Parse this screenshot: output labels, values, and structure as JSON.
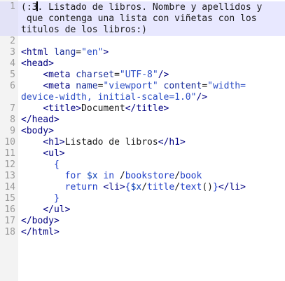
{
  "editor": {
    "lines": [
      {
        "n": "1",
        "parts": [
          [
            "plain",
            "(:3"
          ],
          [
            "cursor",
            ""
          ],
          [
            "plain",
            ". Listado de libros. Nombre y apellidos y"
          ]
        ]
      },
      {
        "n": "",
        "parts": [
          [
            "plain",
            " que contenga una lista con viñetas con los"
          ]
        ]
      },
      {
        "n": "",
        "parts": [
          [
            "plain",
            "titulos de los libros:)"
          ]
        ]
      },
      {
        "n": "2",
        "parts": []
      },
      {
        "n": "3",
        "parts": [
          [
            "tag",
            "<html "
          ],
          [
            "attr",
            "lang"
          ],
          [
            "plain",
            "="
          ],
          [
            "val",
            "\"en\""
          ],
          [
            "tag",
            ">"
          ]
        ]
      },
      {
        "n": "4",
        "parts": [
          [
            "tag",
            "<head>"
          ]
        ]
      },
      {
        "n": "5",
        "parts": [
          [
            "plain",
            "    "
          ],
          [
            "tag",
            "<meta "
          ],
          [
            "attr",
            "charset"
          ],
          [
            "plain",
            "="
          ],
          [
            "val",
            "\"UTF-8\""
          ],
          [
            "tag",
            "/>"
          ]
        ]
      },
      {
        "n": "6",
        "parts": [
          [
            "plain",
            "    "
          ],
          [
            "tag",
            "<meta "
          ],
          [
            "attr",
            "name"
          ],
          [
            "plain",
            "="
          ],
          [
            "val",
            "\"viewport\""
          ],
          [
            "plain",
            " "
          ],
          [
            "attr",
            "content"
          ],
          [
            "plain",
            "="
          ],
          [
            "val",
            "\"width="
          ]
        ]
      },
      {
        "n": "",
        "parts": [
          [
            "val",
            "device-width, initial-scale=1.0\""
          ],
          [
            "tag",
            "/>"
          ]
        ]
      },
      {
        "n": "7",
        "parts": [
          [
            "plain",
            "    "
          ],
          [
            "tag",
            "<title>"
          ],
          [
            "plain",
            "Document"
          ],
          [
            "tag",
            "</title>"
          ]
        ]
      },
      {
        "n": "8",
        "parts": [
          [
            "tag",
            "</head>"
          ]
        ]
      },
      {
        "n": "9",
        "parts": [
          [
            "tag",
            "<body>"
          ]
        ]
      },
      {
        "n": "10",
        "parts": [
          [
            "plain",
            "    "
          ],
          [
            "tag",
            "<h1>"
          ],
          [
            "plain",
            "Listado de libros"
          ],
          [
            "tag",
            "</h1>"
          ]
        ]
      },
      {
        "n": "11",
        "parts": [
          [
            "plain",
            "    "
          ],
          [
            "tag",
            "<ul>"
          ]
        ]
      },
      {
        "n": "12",
        "parts": [
          [
            "plain",
            "      "
          ],
          [
            "brace",
            "{"
          ]
        ]
      },
      {
        "n": "13",
        "parts": [
          [
            "plain",
            "        "
          ],
          [
            "kw",
            "for "
          ],
          [
            "var",
            "$x"
          ],
          [
            "kw",
            " in "
          ],
          [
            "plain",
            "/"
          ],
          [
            "fn",
            "bookstore"
          ],
          [
            "plain",
            "/"
          ],
          [
            "fn",
            "book"
          ]
        ]
      },
      {
        "n": "14",
        "parts": [
          [
            "plain",
            "        "
          ],
          [
            "kw",
            "return "
          ],
          [
            "tag",
            "<li>"
          ],
          [
            "brace",
            "{"
          ],
          [
            "var",
            "$x"
          ],
          [
            "plain",
            "/"
          ],
          [
            "fn",
            "title"
          ],
          [
            "plain",
            "/"
          ],
          [
            "fn",
            "text"
          ],
          [
            "plain",
            "()"
          ],
          [
            "brace",
            "}"
          ],
          [
            "tag",
            "</li>"
          ]
        ]
      },
      {
        "n": "15",
        "parts": [
          [
            "plain",
            "      "
          ],
          [
            "brace",
            "}"
          ]
        ]
      },
      {
        "n": "16",
        "parts": [
          [
            "plain",
            "    "
          ],
          [
            "tag",
            "</ul>"
          ]
        ]
      },
      {
        "n": "17",
        "parts": [
          [
            "tag",
            "</body>"
          ]
        ]
      },
      {
        "n": "18",
        "parts": [
          [
            "tag",
            "</html>"
          ]
        ]
      }
    ]
  }
}
